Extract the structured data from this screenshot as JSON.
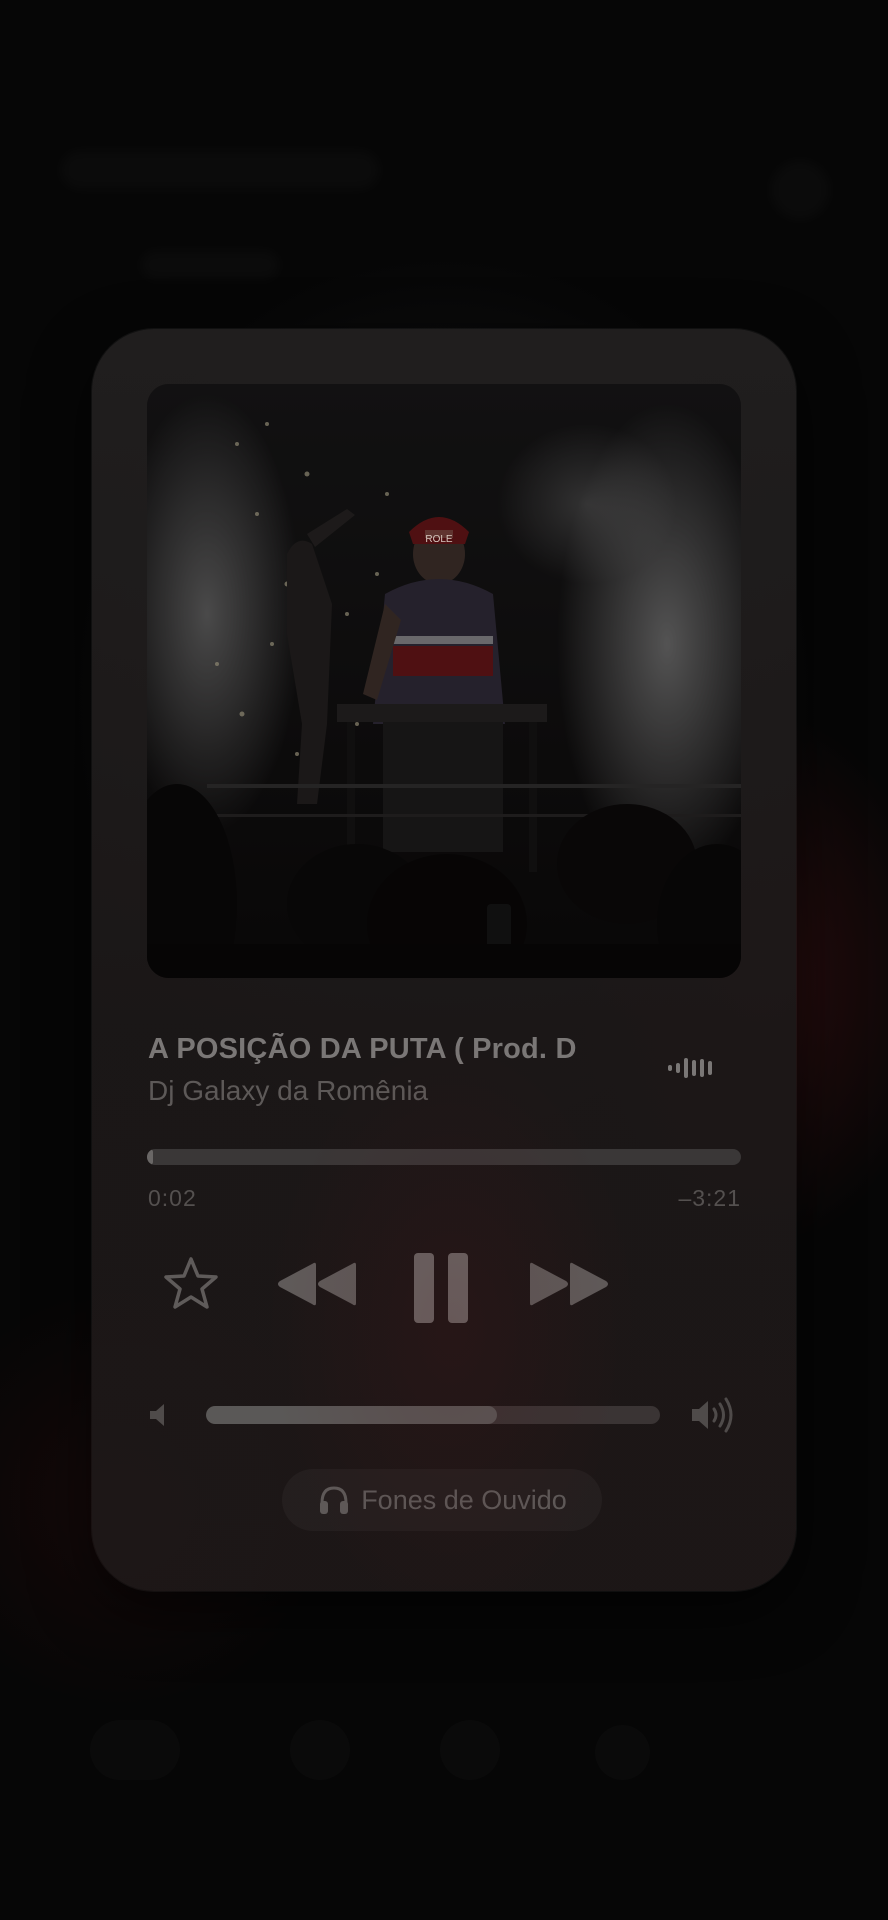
{
  "now_playing": {
    "title": "A POSIÇÃO DA PUTA ( Prod. D",
    "artist": "Dj Galaxy da Romênia",
    "elapsed": "0:02",
    "remaining": "–3:21",
    "progress_fraction": 0.01,
    "cap_text": "ROLE"
  },
  "controls": {
    "favorite_icon": "star-outline-icon",
    "rewind_icon": "backward-icon",
    "pause_icon": "pause-icon",
    "forward_icon": "forward-icon"
  },
  "volume": {
    "level_fraction": 0.64,
    "low_icon": "speaker-low-icon",
    "high_icon": "speaker-high-icon"
  },
  "output": {
    "icon": "headphones-icon",
    "label": "Fones de Ouvido"
  },
  "colors": {
    "card": "#221f1f",
    "text_primary": "#7a7776",
    "text_secondary": "#5d5958",
    "accent_red": "#7a1a1c"
  }
}
